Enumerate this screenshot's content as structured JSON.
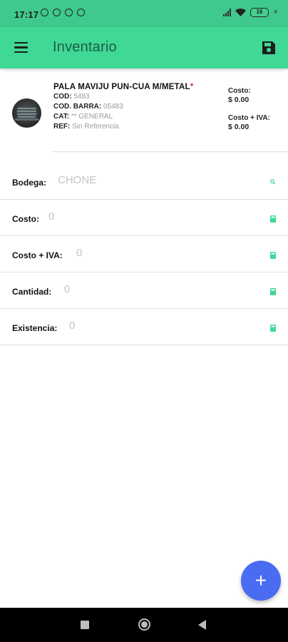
{
  "status_bar": {
    "time": "17:17",
    "battery": "16"
  },
  "app_bar": {
    "title": "Inventario"
  },
  "product": {
    "name": "PALA MAVIJU PUN-CUA M/METAL",
    "required_mark": "*",
    "cod_label": "COD:",
    "cod_value": "5483",
    "barcode_label": "COD. BARRA:",
    "barcode_value": "05483",
    "cat_label": "CAT:",
    "cat_value": "** GENERAL",
    "ref_label": "REF:",
    "ref_value": "Sin Referencia",
    "cost_label": "Costo:",
    "cost_value": "$ 0.00",
    "cost_iva_label": "Costo + IVA:",
    "cost_iva_value": "$ 0.00"
  },
  "form": {
    "bodega": {
      "label": "Bodega:",
      "value": "CHONE"
    },
    "costo": {
      "label": "Costo:",
      "value": "0"
    },
    "costo_iva": {
      "label": "Costo + IVA:",
      "value": "0"
    },
    "cantidad": {
      "label": "Cantidad:",
      "value": "0"
    },
    "existencia": {
      "label": "Existencia:",
      "value": "0"
    }
  },
  "fab": {
    "label": "+"
  },
  "colors": {
    "status_bar": "#3fc98d",
    "app_bar": "#3fd894",
    "accent_icon": "#3fd894",
    "fab": "#4a6cf2",
    "required": "#e02b2b"
  }
}
